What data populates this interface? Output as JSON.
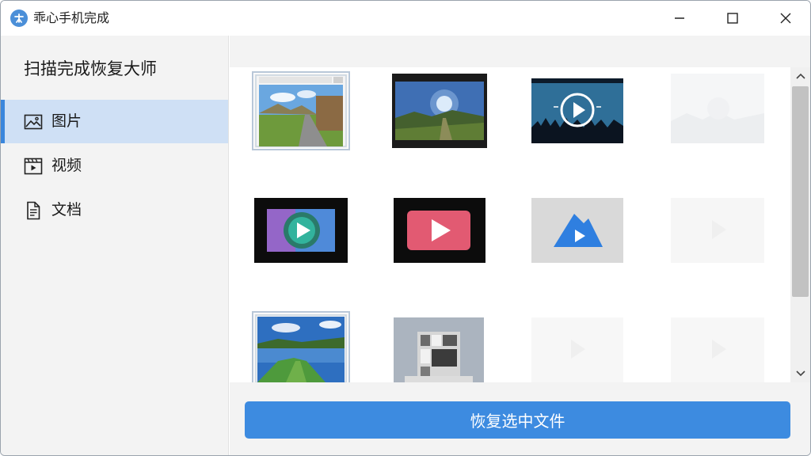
{
  "titlebar": {
    "title": "乖心手机完成",
    "buttons": [
      "minimize-icon",
      "maximize-icon",
      "close-icon"
    ]
  },
  "sidebar": {
    "title": "扫描完成恢复大师",
    "items": [
      {
        "label": "图片",
        "icon": "image-icon",
        "active": true
      },
      {
        "label": "视频",
        "icon": "video-icon",
        "active": false
      },
      {
        "label": "文档",
        "icon": "document-icon",
        "active": false
      }
    ]
  },
  "grid": {
    "thumbnails": [
      {
        "kind": "photo-road",
        "selected": true
      },
      {
        "kind": "photo-field-sunrise",
        "selected": false
      },
      {
        "kind": "video-play-circle",
        "selected": false
      },
      {
        "kind": "faded",
        "selected": false
      },
      {
        "kind": "video-play-purple",
        "selected": false
      },
      {
        "kind": "video-play-red",
        "selected": false
      },
      {
        "kind": "video-play-triangle",
        "selected": false
      },
      {
        "kind": "faded",
        "selected": false
      },
      {
        "kind": "photo-lake",
        "selected": false
      },
      {
        "kind": "photo-room",
        "selected": false
      },
      {
        "kind": "faded",
        "selected": false
      },
      {
        "kind": "faded",
        "selected": false
      }
    ]
  },
  "footer": {
    "recover_label": "恢复选中文件"
  },
  "colors": {
    "accent": "#3d8be0",
    "active_item_bg": "#cfe0f5"
  }
}
